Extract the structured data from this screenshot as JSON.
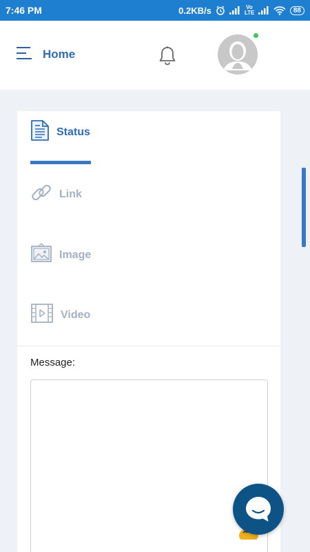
{
  "status_bar": {
    "time": "7:46 PM",
    "net_speed": "0.2KB/s",
    "volte": "Vo LTE",
    "battery": "88"
  },
  "app_bar": {
    "home_label": "Home",
    "icons": [
      "menu-icon",
      "bell-icon",
      "avatar-icon"
    ],
    "online_status_color": "#3ec95c"
  },
  "tabs": [
    {
      "label": "Status",
      "icon": "document-icon",
      "active": true
    },
    {
      "label": "Link",
      "icon": "link-icon",
      "active": false
    },
    {
      "label": "Image",
      "icon": "image-icon",
      "active": false
    },
    {
      "label": "Video",
      "icon": "video-icon",
      "active": false
    }
  ],
  "message": {
    "label": "Message:",
    "value": ""
  },
  "colors": {
    "status_bar": "#1e7fd0",
    "accent": "#2d6cb5",
    "inactive": "#a3b1c2",
    "chat_button": "#0e5385",
    "background": "#eef2f7"
  }
}
